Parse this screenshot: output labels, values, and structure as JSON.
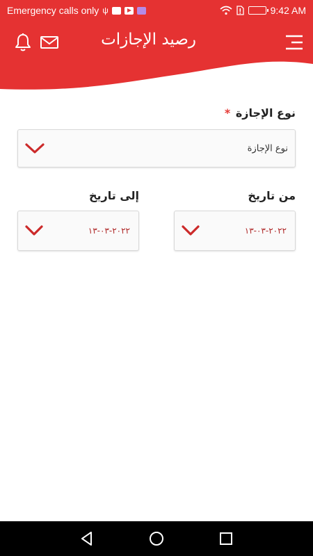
{
  "status_bar": {
    "carrier_text": "Emergency calls only",
    "time": "9:42 AM",
    "usb_glyph": "⚲"
  },
  "header": {
    "title": "رصيد الإجازات",
    "icons": [
      "bell-icon",
      "mail-icon",
      "menu-icon"
    ]
  },
  "form": {
    "leave_type": {
      "label": "نوع الإجازة",
      "required_mark": "*",
      "value": "نوع الإجازة"
    },
    "from_date": {
      "label": "من تاريخ",
      "value": "٢٠٢٢-٠٣-١٣"
    },
    "to_date": {
      "label": "إلى تاريخ",
      "value": "٢٠٢٢-٠٣-١٣"
    }
  },
  "colors": {
    "brand_red": "#e53232",
    "chevron_red": "#cc2a2a",
    "date_text": "#b02a2a"
  }
}
